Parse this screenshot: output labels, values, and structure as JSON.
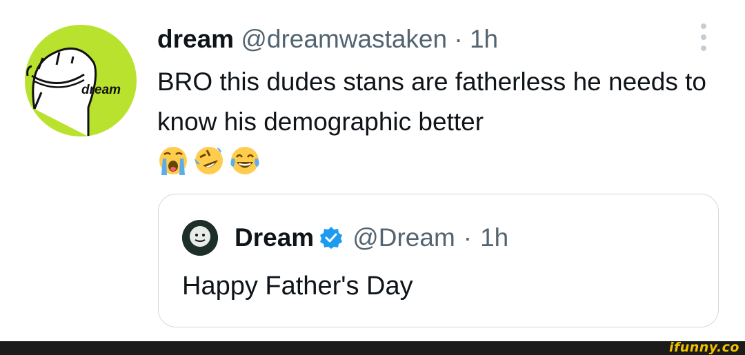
{
  "tweet": {
    "display_name": "dream",
    "handle": "@dreamwastaken",
    "separator": "·",
    "time": "1h",
    "text": "BRO this dudes stans are fatherless he needs to know his demographic better",
    "emojis": [
      "crying-face-emoji",
      "rolling-on-floor-laughing-emoji",
      "tears-of-joy-emoji"
    ],
    "avatar_text": "dream"
  },
  "quoted_tweet": {
    "display_name": "Dream",
    "handle": "@Dream",
    "separator": "·",
    "time": "1h",
    "text": "Happy Father's Day",
    "verified": true
  },
  "watermark": "ifunny.co",
  "colors": {
    "avatar_green": "#b8e22e",
    "verified_blue": "#1d9bf0",
    "secondary_text": "#536471",
    "watermark_yellow": "#f2c200"
  }
}
